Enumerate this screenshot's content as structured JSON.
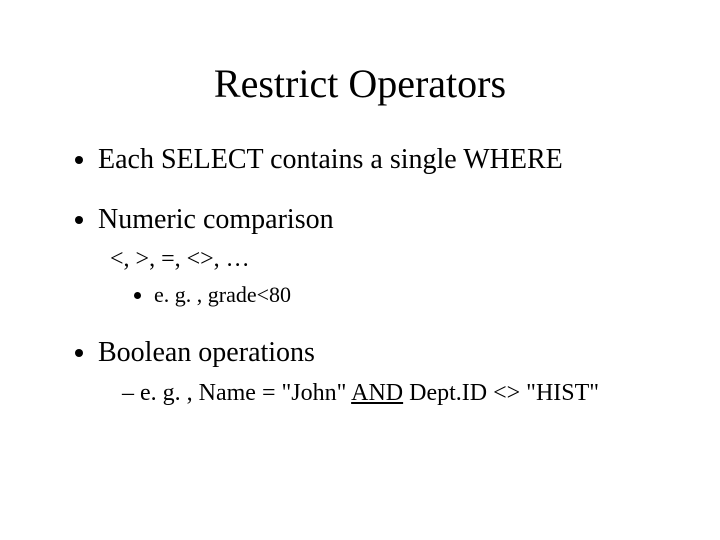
{
  "title": "Restrict Operators",
  "bullets": {
    "b1": "Each SELECT contains a single WHERE",
    "b2": "Numeric comparison",
    "b2_sub": "<, >, =, <>, …",
    "b2_example": "e. g. , grade<80",
    "b3": "Boolean operations",
    "b3_example_pre": "e. g. , Name = \"John\" ",
    "b3_example_and": "AND",
    "b3_example_post": " Dept.ID <> \"HIST\""
  }
}
